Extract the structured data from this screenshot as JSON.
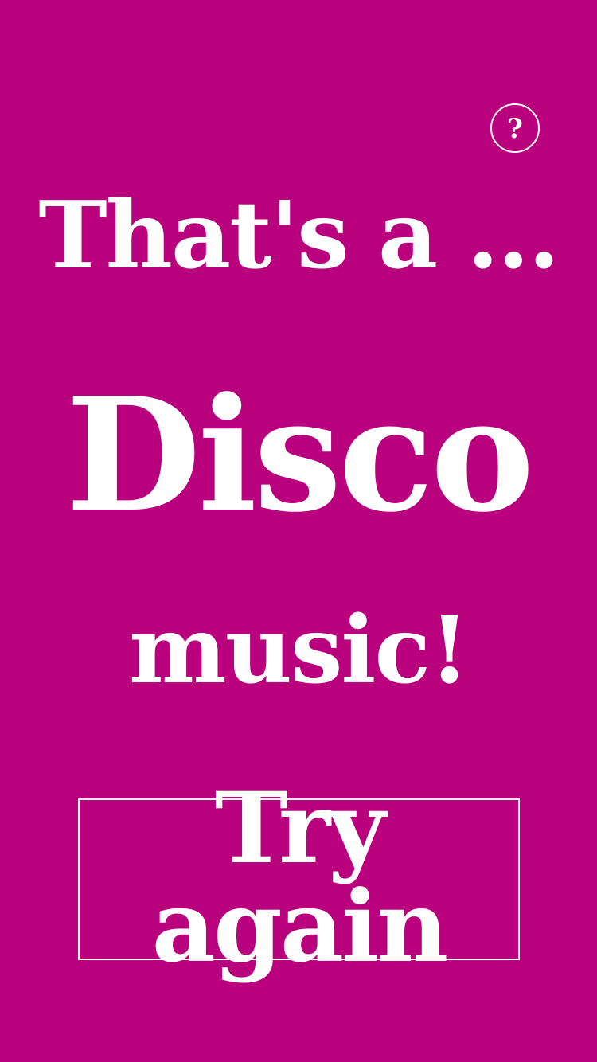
{
  "colors": {
    "background": "#B9017D",
    "foreground": "#FFFFFF"
  },
  "help": {
    "icon": "question-mark-icon",
    "glyph": "?"
  },
  "result": {
    "intro": "That's a ...",
    "genre": "Disco",
    "outro": "music!"
  },
  "actions": {
    "try_again_label": "Try again"
  }
}
